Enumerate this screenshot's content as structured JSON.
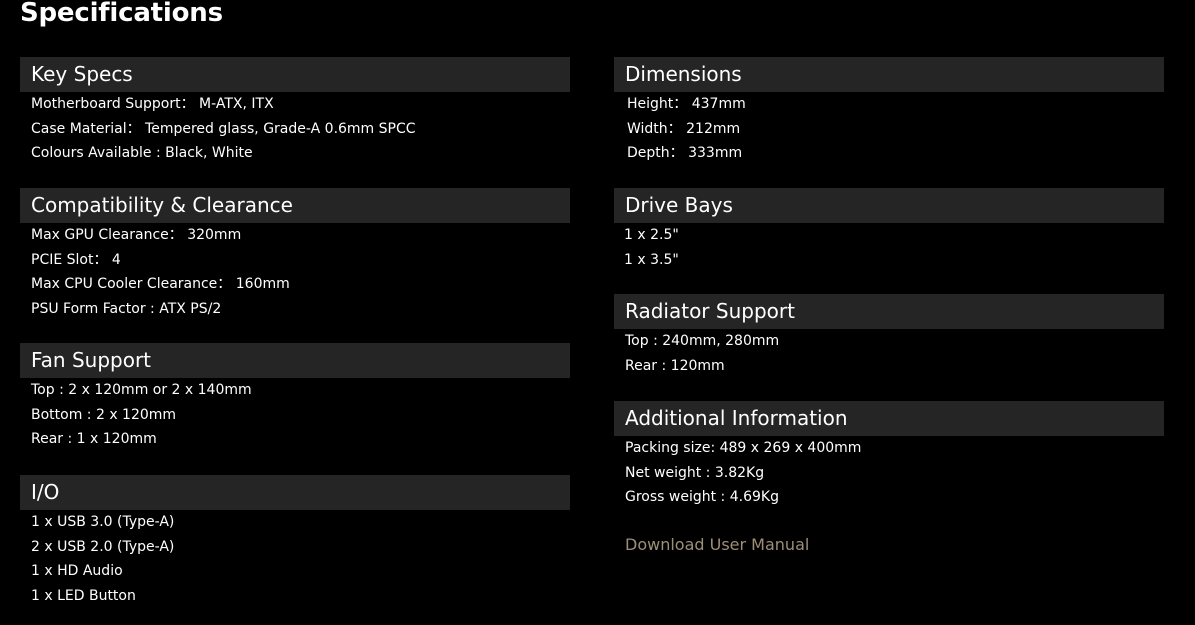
{
  "page": {
    "title": "Specifications"
  },
  "left_sections": [
    {
      "title": "Key Specs",
      "items": [
        "Motherboard Support： M-ATX, ITX",
        "Case Material： Tempered glass, Grade-A 0.6mm SPCC",
        "Colours Available : Black, White"
      ]
    },
    {
      "title": "Compatibility & Clearance",
      "items": [
        "Max GPU Clearance： 320mm",
        "PCIE Slot： 4",
        "Max CPU Cooler Clearance： 160mm",
        "PSU Form Factor : ATX PS/2"
      ]
    },
    {
      "title": "Fan Support",
      "items": [
        "Top : 2 x 120mm or 2 x 140mm",
        "Bottom : 2 x 120mm",
        "Rear : 1 x 120mm"
      ]
    },
    {
      "title": "I/O",
      "items": [
        "1 x USB 3.0 (Type-A)",
        "2 x USB 2.0 (Type-A)",
        "1 x HD Audio",
        "1 x LED Button"
      ]
    }
  ],
  "right_sections": [
    {
      "title": "Dimensions",
      "items": [
        "Height： 437mm",
        "Width： 212mm",
        "Depth： 333mm"
      ]
    },
    {
      "title": "Drive Bays",
      "items": [
        "1 x 2.5\"",
        "1 x 3.5\""
      ]
    },
    {
      "title": "Radiator Support",
      "items": [
        "Top : 240mm, 280mm",
        "Rear : 120mm"
      ]
    },
    {
      "title": "Additional Information",
      "items": [
        "Packing size: 489 x 269 x 400mm",
        "Net weight : 3.82Kg",
        "Gross weight : 4.69Kg"
      ]
    }
  ],
  "download": {
    "label": "Download User Manual"
  },
  "colors": {
    "background": "#000000",
    "section_header_bg": "#252525",
    "text": "#ffffff",
    "link": "#9c8f79"
  }
}
